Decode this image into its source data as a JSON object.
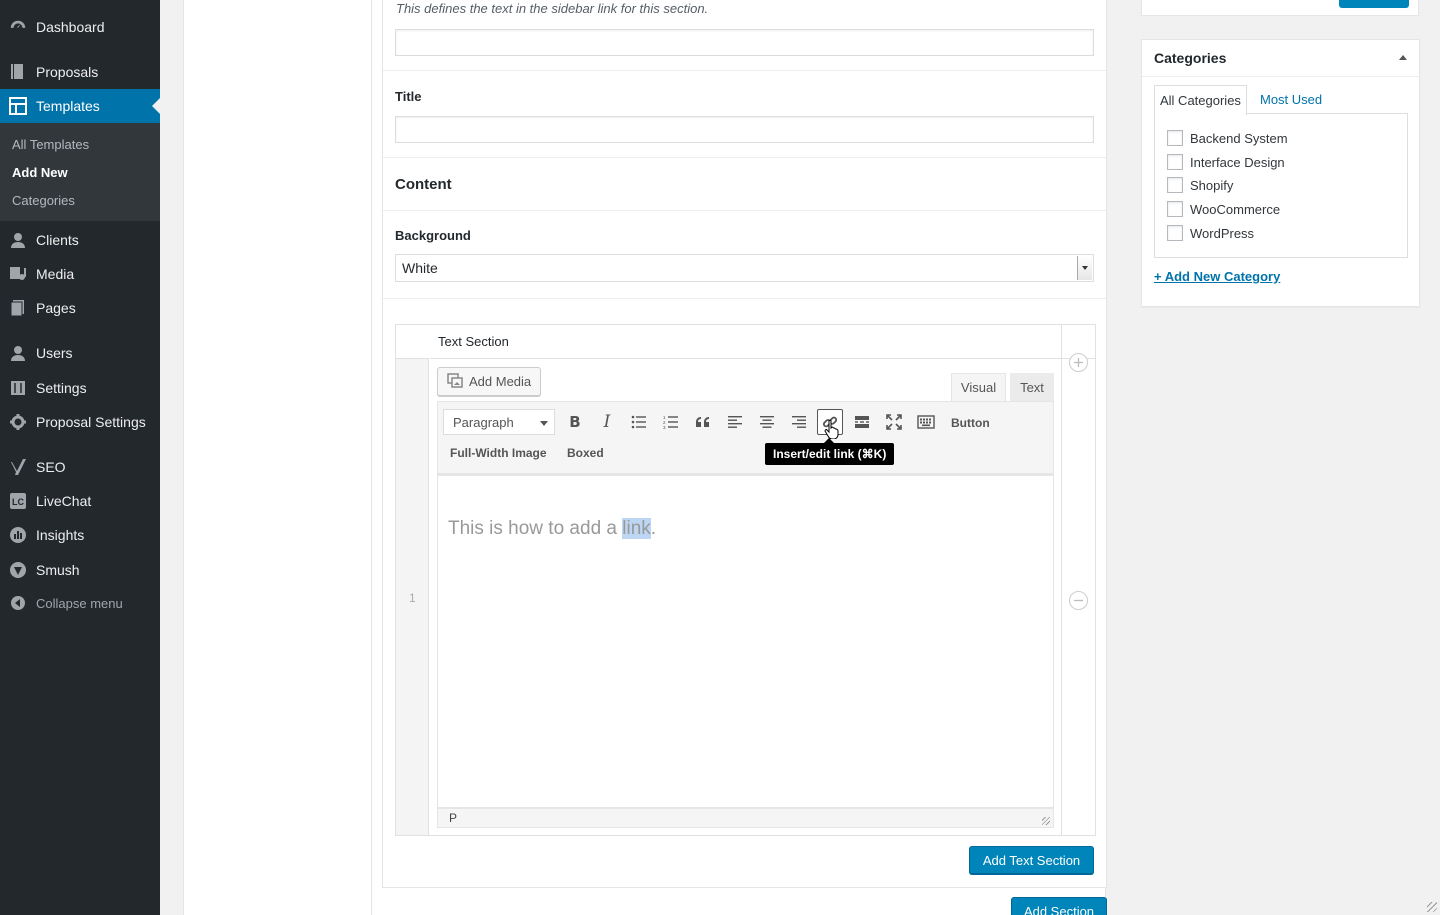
{
  "sidebar": {
    "items": [
      {
        "label": "Dashboard",
        "icon": "dashboard-icon"
      },
      {
        "label": "Proposals",
        "icon": "proposals-icon"
      },
      {
        "label": "Templates",
        "icon": "templates-icon"
      },
      {
        "label": "Clients",
        "icon": "clients-icon"
      },
      {
        "label": "Media",
        "icon": "media-icon"
      },
      {
        "label": "Pages",
        "icon": "pages-icon"
      },
      {
        "label": "Users",
        "icon": "users-icon"
      },
      {
        "label": "Settings",
        "icon": "settings-icon"
      },
      {
        "label": "Proposal Settings",
        "icon": "gear-icon"
      },
      {
        "label": "SEO",
        "icon": "yoast-icon"
      },
      {
        "label": "LiveChat",
        "icon": "livechat-icon"
      },
      {
        "label": "Insights",
        "icon": "insights-icon"
      },
      {
        "label": "Smush",
        "icon": "smush-icon"
      }
    ],
    "submenu": [
      "All Templates",
      "Add New",
      "Categories"
    ],
    "collapse_label": "Collapse menu"
  },
  "form": {
    "sidebar_link_description": "This defines the text in the sidebar link for this section.",
    "sidebar_link_value": "",
    "title_label": "Title",
    "title_value": "",
    "content_heading": "Content",
    "background_label": "Background",
    "background_value": "White"
  },
  "repeater": {
    "row_order": "1",
    "row_header": "Text Section",
    "add_row_icon": "plus",
    "remove_row_icon": "minus"
  },
  "editor": {
    "add_media_label": "Add Media",
    "tab_visual": "Visual",
    "tab_text": "Text",
    "format_value": "Paragraph",
    "bold_glyph": "B",
    "italic_glyph": "I",
    "button_label": "Button",
    "full_width_image_label": "Full-Width Image",
    "boxed_label": "Boxed",
    "tooltip": "Insert/edit link (⌘K)",
    "content_before": "This is how to add a ",
    "content_selected": "link",
    "content_after": ".",
    "status_path": "P"
  },
  "actions": {
    "add_text_section": "Add Text Section",
    "add_section": "Add Section"
  },
  "categories_box": {
    "title": "Categories",
    "tab_all": "All Categories",
    "tab_most_used": "Most Used",
    "items": [
      "Backend System",
      "Interface Design",
      "Shopify",
      "WooCommerce",
      "WordPress"
    ],
    "add_new": "+ Add New Category"
  },
  "colors": {
    "sidebar_bg": "#23282d",
    "accent": "#0073aa",
    "primary_button": "#0085ba"
  }
}
